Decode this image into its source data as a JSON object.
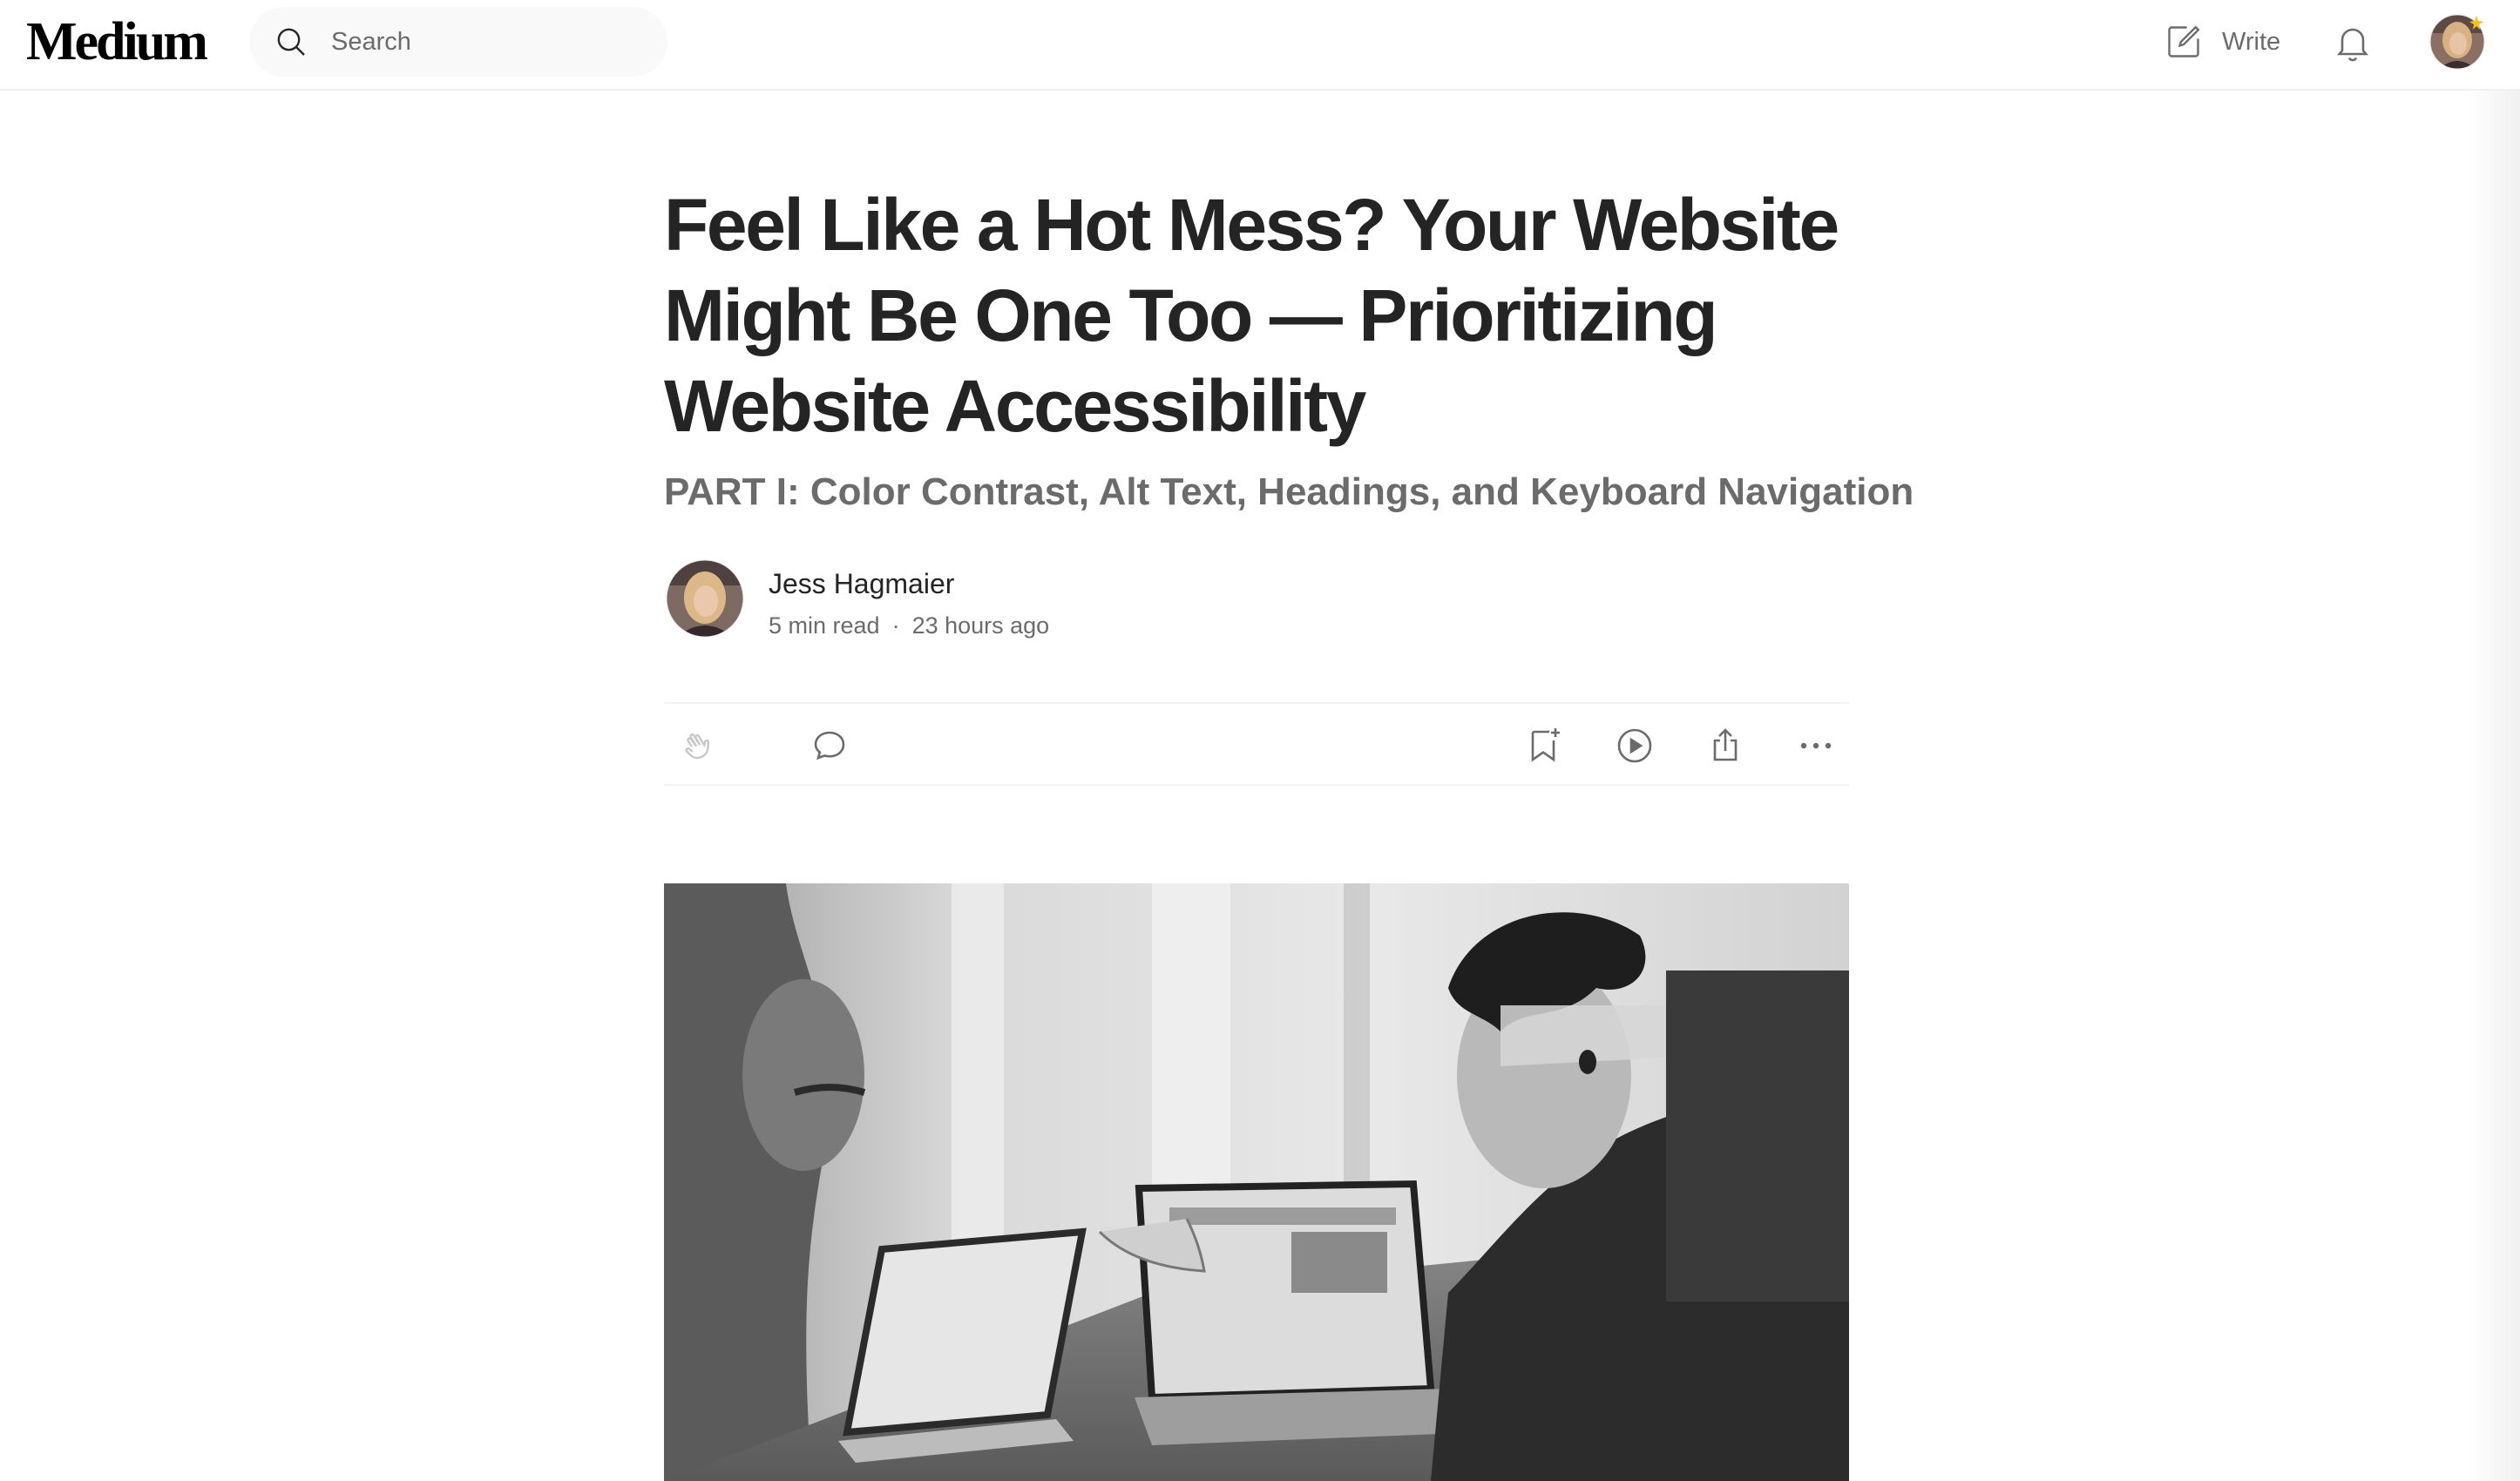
{
  "header": {
    "logo": "Medium",
    "search_placeholder": "Search",
    "write_label": "Write"
  },
  "article": {
    "title": "Feel Like a Hot Mess? Your Website Might Be One Too — Prioritizing Website Accessibility",
    "subtitle": "PART I: Color Contrast, Alt Text, Headings, and Keyboard Navigation",
    "author": "Jess Hagmaier",
    "read_time": "5 min read",
    "separator": "·",
    "published": "23 hours ago"
  },
  "colors": {
    "text": "#242424",
    "muted": "#6b6b6b",
    "search_bg": "#f9f9f9",
    "divider": "#f2f2f2",
    "membership_star": "#ffc017"
  },
  "icons": {
    "search": "search-icon",
    "write": "write-icon",
    "notifications": "bell-icon",
    "clap": "clap-icon",
    "comment": "comment-icon",
    "bookmark": "bookmark-add-icon",
    "listen": "play-icon",
    "share": "share-icon",
    "more": "more-icon"
  }
}
